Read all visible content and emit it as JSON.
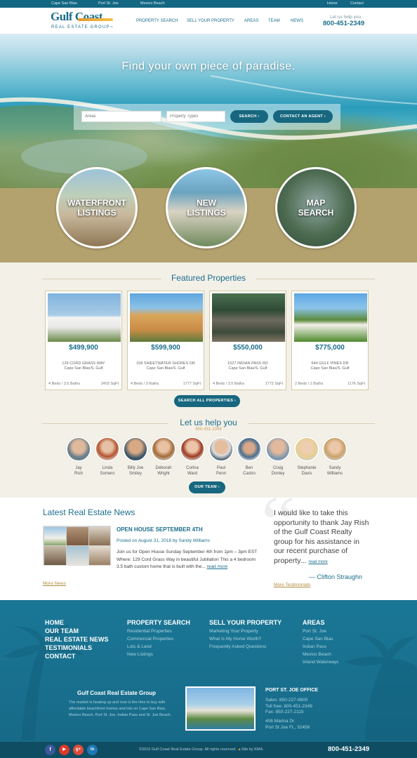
{
  "topbar": {
    "links": [
      "Cape San Blas",
      "Port St. Joe",
      "Mexico Beach"
    ],
    "right": [
      "Home",
      "Contact"
    ]
  },
  "header": {
    "logo_main": "Gulf Coast",
    "logo_sub": "REAL ESTATE GROUP",
    "logo_tm": "™",
    "nav": [
      "PROPERTY SEARCH",
      "SELL YOUR PROPERTY",
      "AREAS",
      "TEAM",
      "NEWS"
    ],
    "help_label": "Let us help you",
    "phone": "800-451-2349"
  },
  "hero": {
    "title": "Find your own piece of paradise.",
    "areas_placeholder": "Areas",
    "types_placeholder": "Property Types",
    "search_button": "SEARCH",
    "contact_button": "CONTACT AN AGENT"
  },
  "quicklinks": [
    {
      "line1": "WATERFRONT",
      "line2": "LISTINGS"
    },
    {
      "line1": "NEW",
      "line2": "LISTINGS"
    },
    {
      "line1": "MAP",
      "line2": "SEARCH"
    }
  ],
  "featured": {
    "title": "Featured Properties",
    "cards": [
      {
        "price": "$499,900",
        "address": "129 CORD GRASS WAY",
        "city": "Cape San Blas/S. Gulf",
        "beds": "4 Beds / 3.5 Baths",
        "sqft": "2403 SqFt"
      },
      {
        "price": "$599,900",
        "address": "158 SWEETWATER SHORES DR",
        "city": "Cape San Blas/S. Gulf",
        "beds": "4 Beds / 3 Baths",
        "sqft": "1777 SqFt"
      },
      {
        "price": "$550,000",
        "address": "1527 INDIAN PASS RD",
        "city": "Cape San Blas/S. Gulf",
        "beds": "4 Beds / 3.5 Baths",
        "sqft": "1772 SqFt"
      },
      {
        "price": "$775,000",
        "address": "644 GULF PINES DR",
        "city": "Cape San Blas/S. Gulf",
        "beds": "2 Beds / 2 Baths",
        "sqft": "1176 SqFt"
      }
    ],
    "search_all": "SEARCH ALL PROPERTIES"
  },
  "team": {
    "title": "Let us help you",
    "phone": "800-451-2349",
    "members": [
      {
        "first": "Jay",
        "last": "Rish"
      },
      {
        "first": "Linda",
        "last": "Somero"
      },
      {
        "first": "Billy Joe",
        "last": "Smiley"
      },
      {
        "first": "Deborah",
        "last": "Wright"
      },
      {
        "first": "Corina",
        "last": "Ward"
      },
      {
        "first": "Paul",
        "last": "Penn"
      },
      {
        "first": "Ben",
        "last": "Castro"
      },
      {
        "first": "Craig",
        "last": "Donley"
      },
      {
        "first": "Stephanie",
        "last": "Davis"
      },
      {
        "first": "Sandy",
        "last": "Williams"
      }
    ],
    "button": "OUR TEAM"
  },
  "news": {
    "title": "Latest Real Estate News",
    "post_title": "OPEN HOUSE SEPTEMBER 4TH",
    "post_meta": "Posted on August 31, 2016 by Sandy Williams",
    "post_body": "Join us for Open House Sunday September 4th  from 1pm – 3pm EST Where: 129 Cord Grass Way in beautiful Jubilation This a 4 bedroom 3.5 bath custom home that is built with the...",
    "read_more": "read more",
    "more_news": "More News"
  },
  "testimonial": {
    "quote": "I would like to take this opportunity to thank Jay Rish of the Gulf Coast Realty group for his assistance in our recent purchase of property...",
    "read_more": "read more",
    "author": "— Clifton Straughn",
    "more": "More Testimonials"
  },
  "footer": {
    "col1": [
      "HOME",
      "OUR TEAM",
      "REAL ESTATE NEWS",
      "TESTIMONIALS",
      "CONTACT"
    ],
    "col2_title": "PROPERTY SEARCH",
    "col2": [
      "Residential Properties",
      "Commercial Properties",
      "Lots & Land",
      "New Listings"
    ],
    "col3_title": "SELL YOUR PROPERTY",
    "col3": [
      "Marketing Your Property",
      "What Is My Home Worth?",
      "Frequently Asked Questions"
    ],
    "col4_title": "AREAS",
    "col4": [
      "Port St. Joe",
      "Cape San Blas",
      "Indian Pass",
      "Mexico Beach",
      "Inland Waterways"
    ],
    "company_title": "Gulf Coast Real Estate Group",
    "company_text": "The market is heating up and now is the time to buy with affordable beachfront homes and lots on Cape San Blas, Mexico Beach, Port St. Joe, Indian Pass and St. Joe Beach.",
    "office_title": "PORT ST. JOE OFFICE",
    "office_sales": "Sales: 850-227-9600",
    "office_tollfree": "Toll free: 800-451-2349",
    "office_fax": "Fax: 850-227-2115",
    "office_addr1": "406 Marina Dr.",
    "office_addr2": "Port St Joe FL, 32456"
  },
  "bottom": {
    "social": [
      "f",
      "▶",
      "g+",
      "in"
    ],
    "copyright": "©2016 Gulf Coast Real Estate Group. All rights reserved.",
    "credit": "Site by KMA.",
    "phone": "800-451-2349"
  },
  "colors": {
    "brand": "#1b6e8c",
    "button": "#17677f",
    "tan": "#b4a26e",
    "footer": "#1a7796",
    "orange": "#e6972a"
  }
}
